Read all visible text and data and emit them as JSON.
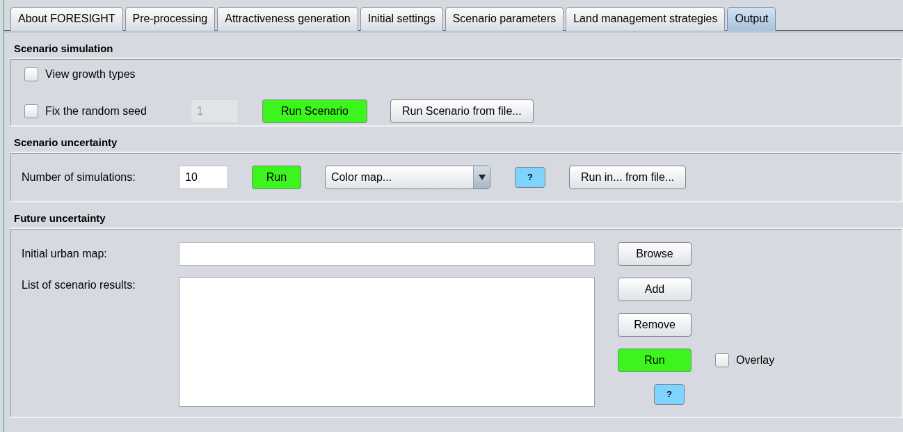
{
  "tabs": [
    {
      "label": "About FORESIGHT",
      "selected": false
    },
    {
      "label": "Pre-processing",
      "selected": false
    },
    {
      "label": "Attractiveness generation",
      "selected": false
    },
    {
      "label": "Initial settings",
      "selected": false
    },
    {
      "label": "Scenario parameters",
      "selected": false
    },
    {
      "label": "Land management strategies",
      "selected": false
    },
    {
      "label": "Output",
      "selected": true
    }
  ],
  "scenario_simulation": {
    "title": "Scenario simulation",
    "view_growth_types": {
      "label": "View growth types",
      "checked": false
    },
    "fix_seed": {
      "label": "Fix the random seed",
      "checked": false
    },
    "seed": {
      "value": "1",
      "disabled": true
    },
    "buttons": [
      {
        "label": "Run Scenario",
        "kind": "run"
      },
      {
        "label": "Run Scenario from file...",
        "kind": "plain"
      }
    ]
  },
  "scenario_uncertainty": {
    "title": "Scenario uncertainty",
    "label": "Number of simulations:",
    "simulations": {
      "value": "10"
    },
    "run_button": {
      "label": "Run",
      "kind": "run"
    },
    "color_map": {
      "value": "Color map..."
    },
    "help_button": {
      "label": "?",
      "kind": "help"
    },
    "file_button": {
      "label": "Run in... from file...",
      "kind": "plain"
    }
  },
  "future_uncertainty": {
    "title": "Future uncertainty",
    "initial_map_label": "Initial urban map:",
    "results_label": "List of scenario results:",
    "buttons": [
      {
        "label": "Browse",
        "kind": "plain"
      },
      {
        "label": "Add",
        "kind": "plain"
      },
      {
        "label": "Remove",
        "kind": "plain"
      },
      {
        "label": "Run",
        "kind": "run"
      }
    ],
    "overlay": {
      "label": "Overlay",
      "checked": false
    },
    "help_button": {
      "label": "?",
      "kind": "help"
    }
  }
}
